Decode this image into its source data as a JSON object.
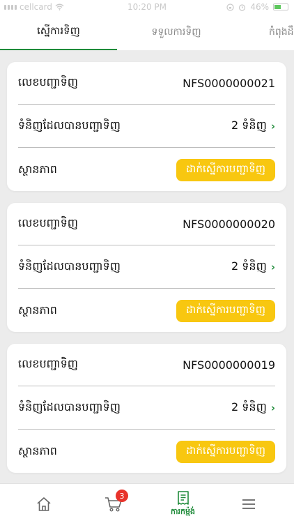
{
  "status_bar": {
    "carrier": "cellcard",
    "time": "10:20 PM",
    "battery": "46%"
  },
  "tabs": [
    {
      "label": "ស្នើការទិញ",
      "active": true
    },
    {
      "label": "ទទួលការទិញ",
      "active": false
    },
    {
      "label": "កំពុងដឹក",
      "active": false
    }
  ],
  "labels": {
    "order_number": "លេខបញ្ជាទិញ",
    "ordered_items": "ទំនិញដែលបានបញ្ជាទិញ",
    "status": "ស្ថានភាព"
  },
  "orders": [
    {
      "order_number": "NFS0000000021",
      "items_count": "2 ទំនិញ",
      "status": "ដាក់ស្នើការបញ្ជាទិញ"
    },
    {
      "order_number": "NFS0000000020",
      "items_count": "2 ទំនិញ",
      "status": "ដាក់ស្នើការបញ្ជាទិញ"
    },
    {
      "order_number": "NFS0000000019",
      "items_count": "2 ទំនិញ",
      "status": "ដាក់ស្នើការបញ្ជាទិញ"
    }
  ],
  "bottom_nav": {
    "home": {
      "icon": "home-icon"
    },
    "cart": {
      "icon": "cart-icon",
      "badge": "3"
    },
    "orders": {
      "icon": "receipt-icon",
      "label": "ការកម្ម៉ង់"
    },
    "menu": {
      "icon": "menu-icon"
    }
  },
  "colors": {
    "accent": "#1f8b3a",
    "status_button": "#f8c710",
    "badge": "#e8332b"
  }
}
